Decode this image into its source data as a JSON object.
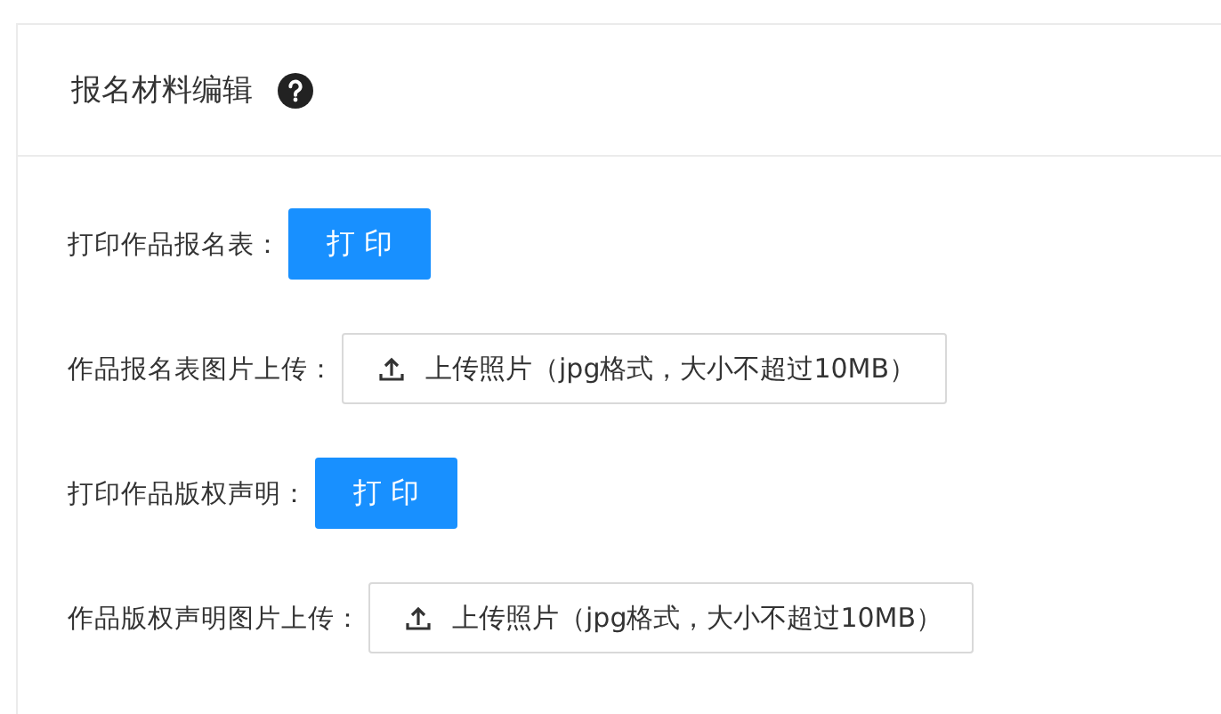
{
  "card": {
    "title": "报名材料编辑",
    "items": [
      {
        "kind": "print",
        "label": "打印作品报名表：",
        "button": "打 印"
      },
      {
        "kind": "upload",
        "label": "作品报名表图片上传：",
        "button": "上传照片（jpg格式，大小不超过10MB）"
      },
      {
        "kind": "print",
        "label": "打印作品版权声明：",
        "button": "打 印"
      },
      {
        "kind": "upload",
        "label": "作品版权声明图片上传：",
        "button": "上传照片（jpg格式，大小不超过10MB）"
      }
    ]
  }
}
